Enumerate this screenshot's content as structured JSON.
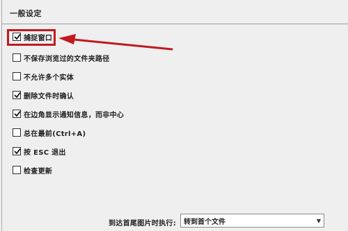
{
  "section": {
    "title": "一般设定"
  },
  "options": [
    {
      "label": "捕捉窗口",
      "checked": true
    },
    {
      "label": "不保存浏览过的文件夹路径",
      "checked": false
    },
    {
      "label": "不允许多个实体",
      "checked": false
    },
    {
      "label": "删除文件时确认",
      "checked": true
    },
    {
      "label": "在边角显示通知信息，而非中心",
      "checked": true
    },
    {
      "label": "总在最前(Ctrl+A)",
      "checked": false
    },
    {
      "label": "按 ESC 退出",
      "checked": true
    },
    {
      "label": "检查更新",
      "checked": false
    }
  ],
  "end_action": {
    "label": "到达首尾图片时执行:",
    "selected": "转到首个文件"
  },
  "colors": {
    "highlight": "#c01a20",
    "background": "#efefef"
  }
}
